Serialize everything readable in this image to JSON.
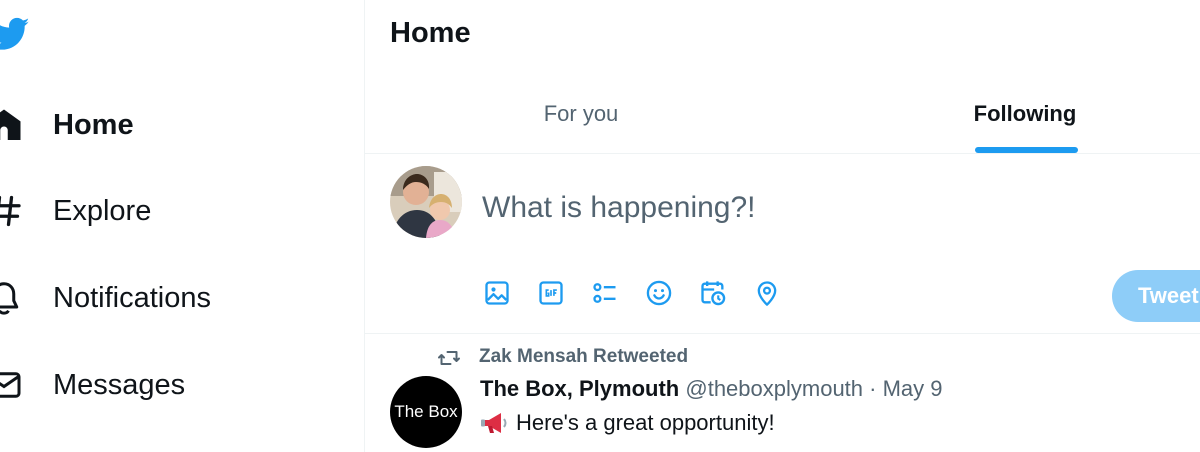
{
  "colors": {
    "accent": "#1d9bf0",
    "tweet_button_disabled": "#8ecdf8",
    "text_primary": "#0f1419",
    "text_secondary": "#536471"
  },
  "sidebar": {
    "logo_icon": "bird-icon",
    "items": [
      {
        "label": "Home",
        "icon": "home-icon",
        "active": true
      },
      {
        "label": "Explore",
        "icon": "hashtag-icon",
        "active": false
      },
      {
        "label": "Notifications",
        "icon": "bell-icon",
        "active": false
      },
      {
        "label": "Messages",
        "icon": "envelope-icon",
        "active": false
      }
    ]
  },
  "main": {
    "title": "Home",
    "tabs": [
      {
        "label": "For you",
        "active": false
      },
      {
        "label": "Following",
        "active": true
      }
    ],
    "composer": {
      "placeholder": "What is happening?!",
      "tools": [
        "image-icon",
        "gif-icon",
        "poll-icon",
        "emoji-icon",
        "schedule-icon",
        "location-icon"
      ],
      "tweet_button": "Tweet"
    },
    "tweet": {
      "retweeted_by": "Zak Mensah Retweeted",
      "avatar_text": "The Box",
      "author": "The Box, Plymouth",
      "handle": "@theboxplymouth",
      "separator": "·",
      "date": "May 9",
      "body": "Here's a great opportunity!"
    }
  }
}
